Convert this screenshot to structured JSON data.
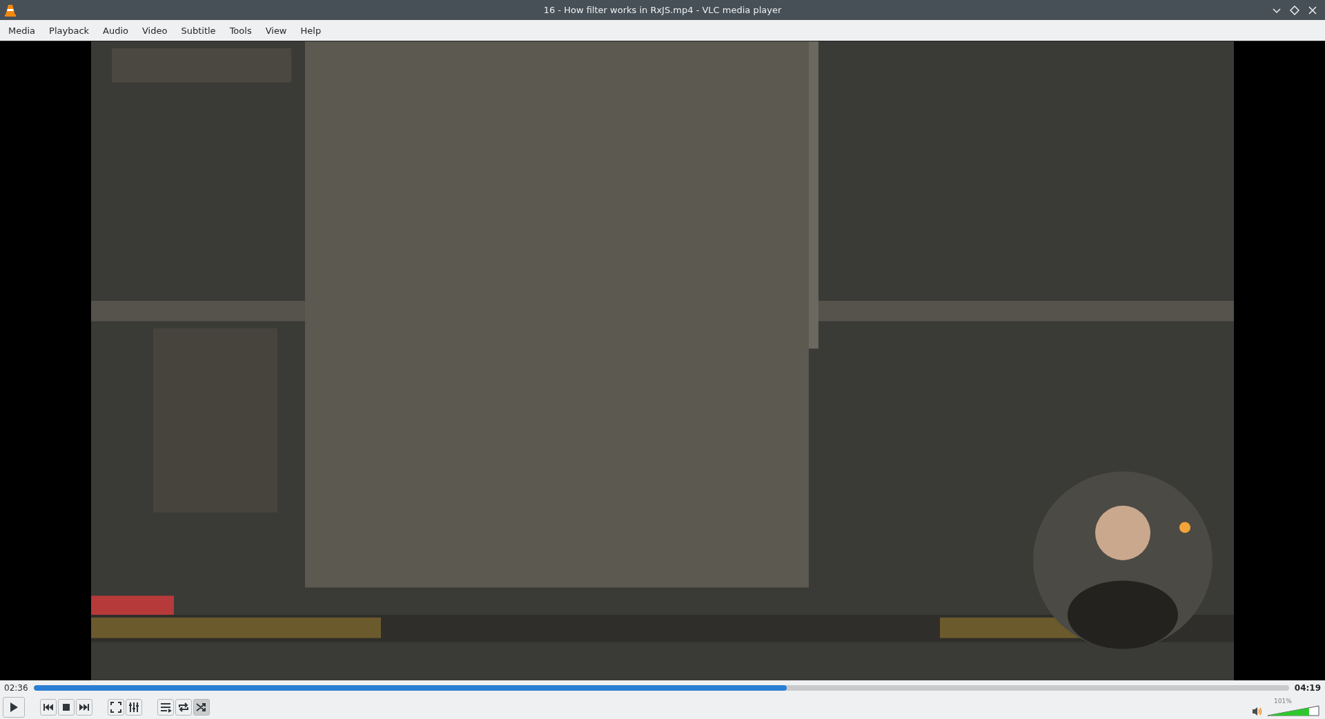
{
  "window": {
    "title": "16 - How filter works in RxJS.mp4 - VLC media player"
  },
  "menu": [
    {
      "label": "Media"
    },
    {
      "label": "Playback"
    },
    {
      "label": "Audio"
    },
    {
      "label": "Video"
    },
    {
      "label": "Subtitle"
    },
    {
      "label": "Tools"
    },
    {
      "label": "View"
    },
    {
      "label": "Help"
    }
  ],
  "seek": {
    "elapsed": "02:36",
    "total": "04:19",
    "level": 0.6
  },
  "controls": [
    {
      "kind": "play",
      "pressed": false
    },
    {
      "kind": "gap"
    },
    {
      "kind": "previous",
      "pressed": false
    },
    {
      "kind": "stop",
      "pressed": false
    },
    {
      "kind": "next",
      "pressed": false
    },
    {
      "kind": "gap"
    },
    {
      "kind": "fullscreen",
      "pressed": false
    },
    {
      "kind": "extended",
      "pressed": false
    },
    {
      "kind": "gap"
    },
    {
      "kind": "playlist",
      "pressed": false
    },
    {
      "kind": "loop",
      "pressed": false
    },
    {
      "kind": "shuffle",
      "pressed": true
    }
  ],
  "volume": {
    "reading": "101%",
    "level": 0.81
  }
}
